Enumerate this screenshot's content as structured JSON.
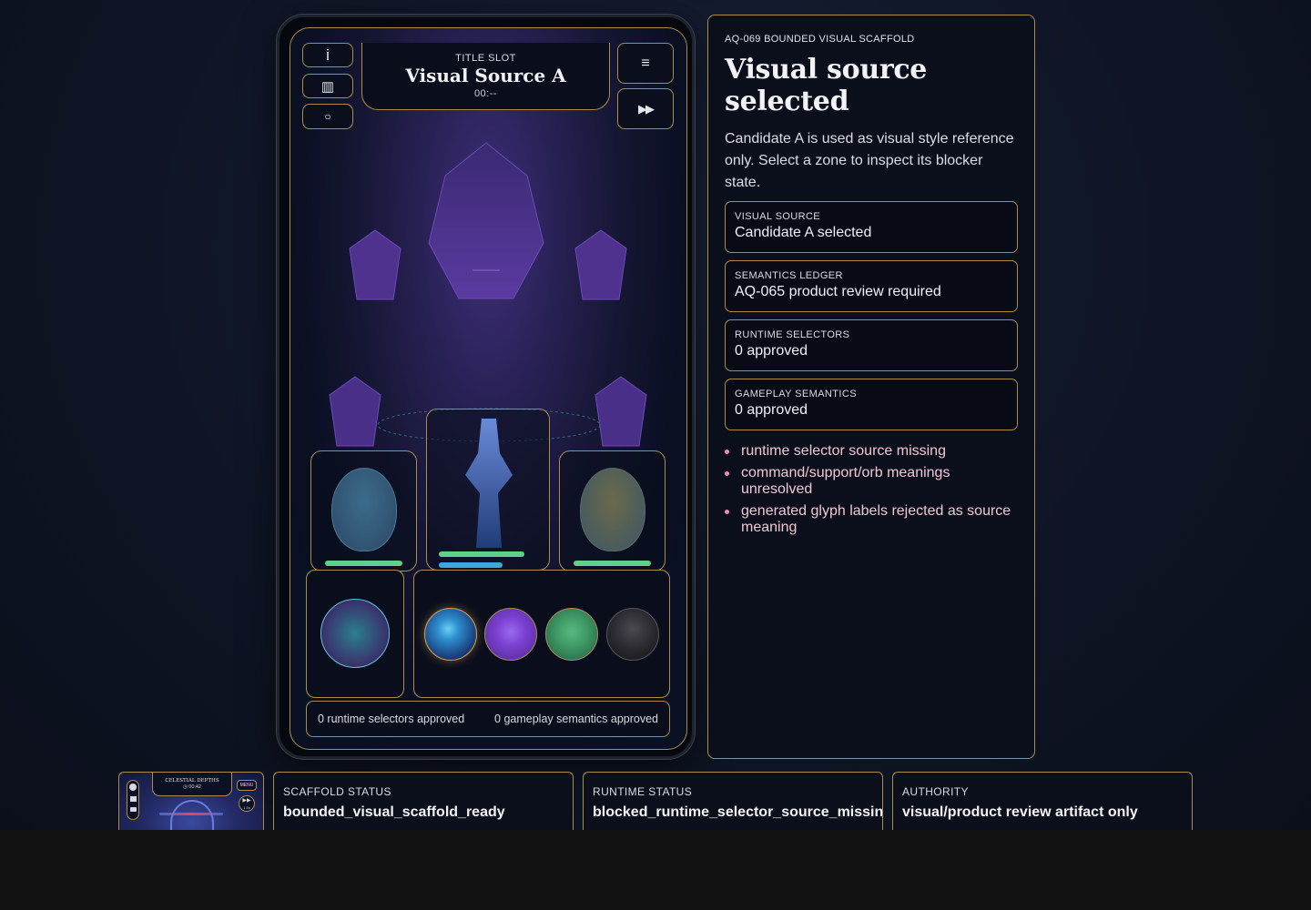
{
  "hud": {
    "info_icon": "i",
    "stats_icon": "▥",
    "chat_icon": "○",
    "menu_icon": "≡",
    "speed_icon": "▶▶",
    "title_label": "TITLE SLOT",
    "title": "Visual Source A",
    "timer": "00:--"
  },
  "board": {
    "footer_left": "0 runtime selectors approved",
    "footer_right": "0 gameplay semantics approved",
    "orbs": [
      {
        "name": "blue-orb",
        "color": "#2e8fd0",
        "selected": true
      },
      {
        "name": "purple-orb",
        "color": "#7a3fcf",
        "selected": false
      },
      {
        "name": "green-orb",
        "color": "#3f9a66",
        "selected": false
      },
      {
        "name": "dark-orb",
        "color": "#3a3a3e",
        "selected": false
      }
    ],
    "portrait_orb_color": "#2a7f8f",
    "hp_bar_color": "#5fd08a",
    "mana_bar_color": "#3fa8d8"
  },
  "panel": {
    "eyebrow": "AQ-069 BOUNDED VISUAL SCAFFOLD",
    "heading": "Visual source selected",
    "description": "Candidate A is used as visual style reference only. Select a zone to inspect its blocker state.",
    "stats": [
      {
        "label": "VISUAL SOURCE",
        "value": "Candidate A selected"
      },
      {
        "label": "SEMANTICS LEDGER",
        "value": "AQ-065 product review required"
      },
      {
        "label": "RUNTIME SELECTORS",
        "value": "0 approved"
      },
      {
        "label": "GAMEPLAY SEMANTICS",
        "value": "0 approved"
      }
    ],
    "blockers": [
      "runtime selector source missing",
      "command/support/orb meanings unresolved",
      "generated glyph labels rejected as source meaning"
    ]
  },
  "thumbnail": {
    "title": "CELESTIAL DEPTHS",
    "timer": "◷ 00:42",
    "menu": "MENU",
    "speed": "1.5x"
  },
  "status": [
    {
      "label": "SCAFFOLD STATUS",
      "value": "bounded_visual_scaffold_ready"
    },
    {
      "label": "RUNTIME STATUS",
      "value": "blocked_runtime_selector_source_missing"
    },
    {
      "label": "AUTHORITY",
      "value": "visual/product review artifact only"
    }
  ],
  "colors": {
    "gold_border": "#a98c4e",
    "blocker_text": "#f2c6d2",
    "crystal_purple": "#5a3a9a"
  }
}
